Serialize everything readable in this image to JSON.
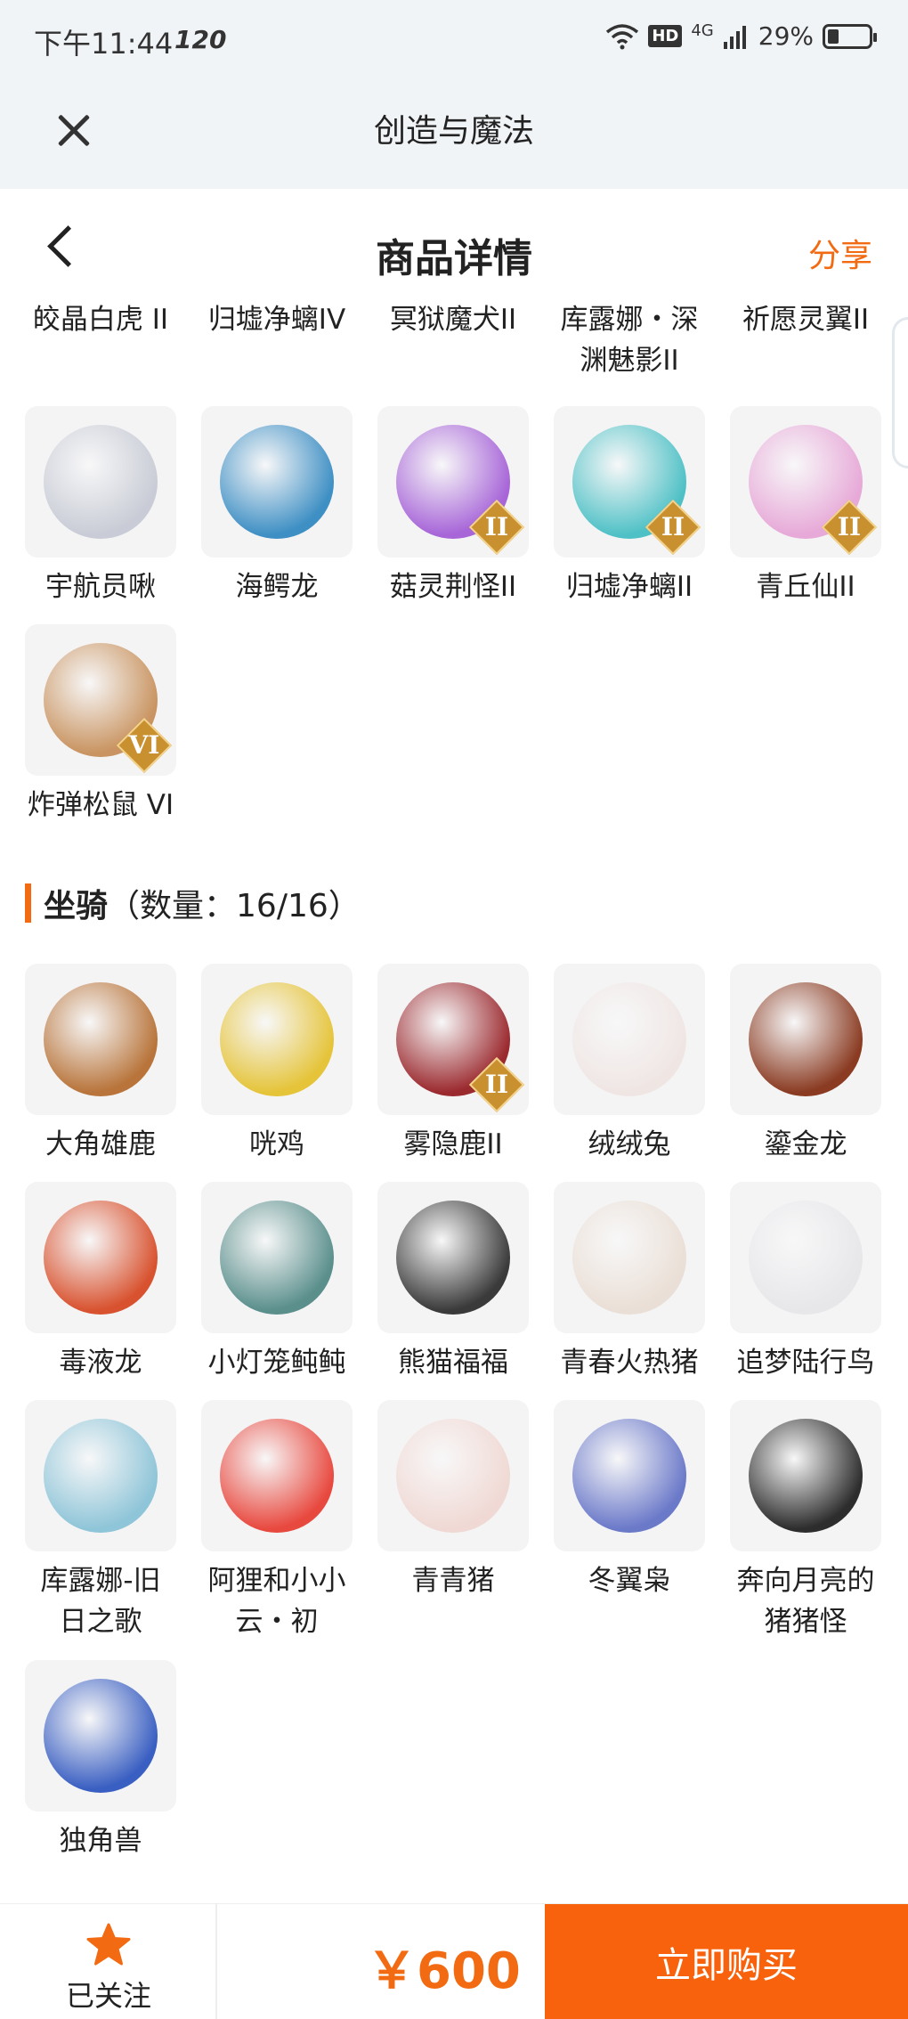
{
  "status": {
    "time": "下午11:44",
    "refresh": "120",
    "network": "4G",
    "battery": "29%"
  },
  "app": {
    "title": "创造与魔法"
  },
  "header": {
    "title": "商品详情",
    "share": "分享"
  },
  "top_labels": [
    {
      "lines": [
        "皎晶白虎 II"
      ]
    },
    {
      "lines": [
        "归墟净螭IV"
      ]
    },
    {
      "lines": [
        "冥狱魔犬II"
      ]
    },
    {
      "lines": [
        "库露娜・深",
        "渊魅影II"
      ]
    },
    {
      "lines": [
        "祈愿灵翼II"
      ]
    }
  ],
  "pets": [
    {
      "label": "宇航员啾",
      "rank": "",
      "color": "#c9ccd6",
      "icon": "astronaut-icon"
    },
    {
      "label": "海鳄龙",
      "rank": "",
      "color": "#3e8fc4",
      "icon": "dragon-icon"
    },
    {
      "label": "菇灵荆怪II",
      "rank": "II",
      "color": "#a765d8",
      "icon": "mushroom-icon"
    },
    {
      "label": "归墟净螭II",
      "rank": "II",
      "color": "#4fc1c6",
      "icon": "serpent-icon"
    },
    {
      "label": "青丘仙II",
      "rank": "II",
      "color": "#e7a9d8",
      "icon": "fox-spirit-icon"
    },
    {
      "label": "炸弹松鼠 VI",
      "rank": "VI",
      "color": "#c99461",
      "icon": "squirrel-icon"
    }
  ],
  "mounts_section": {
    "name": "坐骑",
    "count": "（数量：16/16）"
  },
  "mounts": [
    {
      "label": "大角雄鹿",
      "lines": [
        "大角雄鹿"
      ],
      "rank": "",
      "color": "#b8743a",
      "icon": "deer-icon"
    },
    {
      "label": "咣鸡",
      "lines": [
        "咣鸡"
      ],
      "rank": "",
      "color": "#e5c43a",
      "icon": "chicken-icon"
    },
    {
      "label": "雾隐鹿II",
      "lines": [
        "雾隐鹿II"
      ],
      "rank": "II",
      "color": "#9b2a2f",
      "icon": "red-deer-icon"
    },
    {
      "label": "绒绒兔",
      "lines": [
        "绒绒兔"
      ],
      "rank": "",
      "color": "#efe6e4",
      "icon": "rabbit-icon"
    },
    {
      "label": "鎏金龙",
      "lines": [
        "鎏金龙"
      ],
      "rank": "",
      "color": "#8a3b22",
      "icon": "gold-dragon-icon"
    },
    {
      "label": "毒液龙",
      "lines": [
        "毒液龙"
      ],
      "rank": "",
      "color": "#d8522f",
      "icon": "venom-dragon-icon"
    },
    {
      "label": "小灯笼鲀鲀",
      "lines": [
        "小灯笼鲀鲀"
      ],
      "rank": "",
      "color": "#5a8f8c",
      "icon": "fish-icon"
    },
    {
      "label": "熊猫福福",
      "lines": [
        "熊猫福福"
      ],
      "rank": "",
      "color": "#3a3a3a",
      "icon": "panda-icon"
    },
    {
      "label": "青春火热猪",
      "lines": [
        "青春火热猪"
      ],
      "rank": "",
      "color": "#eadfd6",
      "icon": "pig-icon"
    },
    {
      "label": "追梦陆行鸟",
      "lines": [
        "追梦陆行鸟"
      ],
      "rank": "",
      "color": "#e7e7ea",
      "icon": "bird-icon"
    },
    {
      "label": "库露娜-旧日之歌",
      "lines": [
        "库露娜-旧",
        "日之歌"
      ],
      "rank": "",
      "color": "#8fc5d8",
      "icon": "girl-icon"
    },
    {
      "label": "阿狸和小小云・初",
      "lines": [
        "阿狸和小小",
        "云・初"
      ],
      "rank": "",
      "color": "#e8493f",
      "icon": "fox-cloud-icon"
    },
    {
      "label": "青青猪",
      "lines": [
        "青青猪"
      ],
      "rank": "",
      "color": "#f0d9d4",
      "icon": "green-pig-icon"
    },
    {
      "label": "冬翼枭",
      "lines": [
        "冬翼枭"
      ],
      "rank": "",
      "color": "#6b79c9",
      "icon": "owl-icon"
    },
    {
      "label": "奔向月亮的猪猪怪",
      "lines": [
        "奔向月亮的",
        "猪猪怪"
      ],
      "rank": "",
      "color": "#2d2d2d",
      "icon": "black-pig-icon"
    },
    {
      "label": "独角兽",
      "lines": [
        "独角兽"
      ],
      "rank": "",
      "color": "#3a5fc2",
      "icon": "unicorn-icon"
    }
  ],
  "bottom": {
    "follow_label": "已关注",
    "price": "￥600",
    "buy_label": "立即购买"
  },
  "colors": {
    "accent": "#f26a12",
    "buy_button": "#f9620c",
    "tile_bg": "#f4f4f5"
  }
}
